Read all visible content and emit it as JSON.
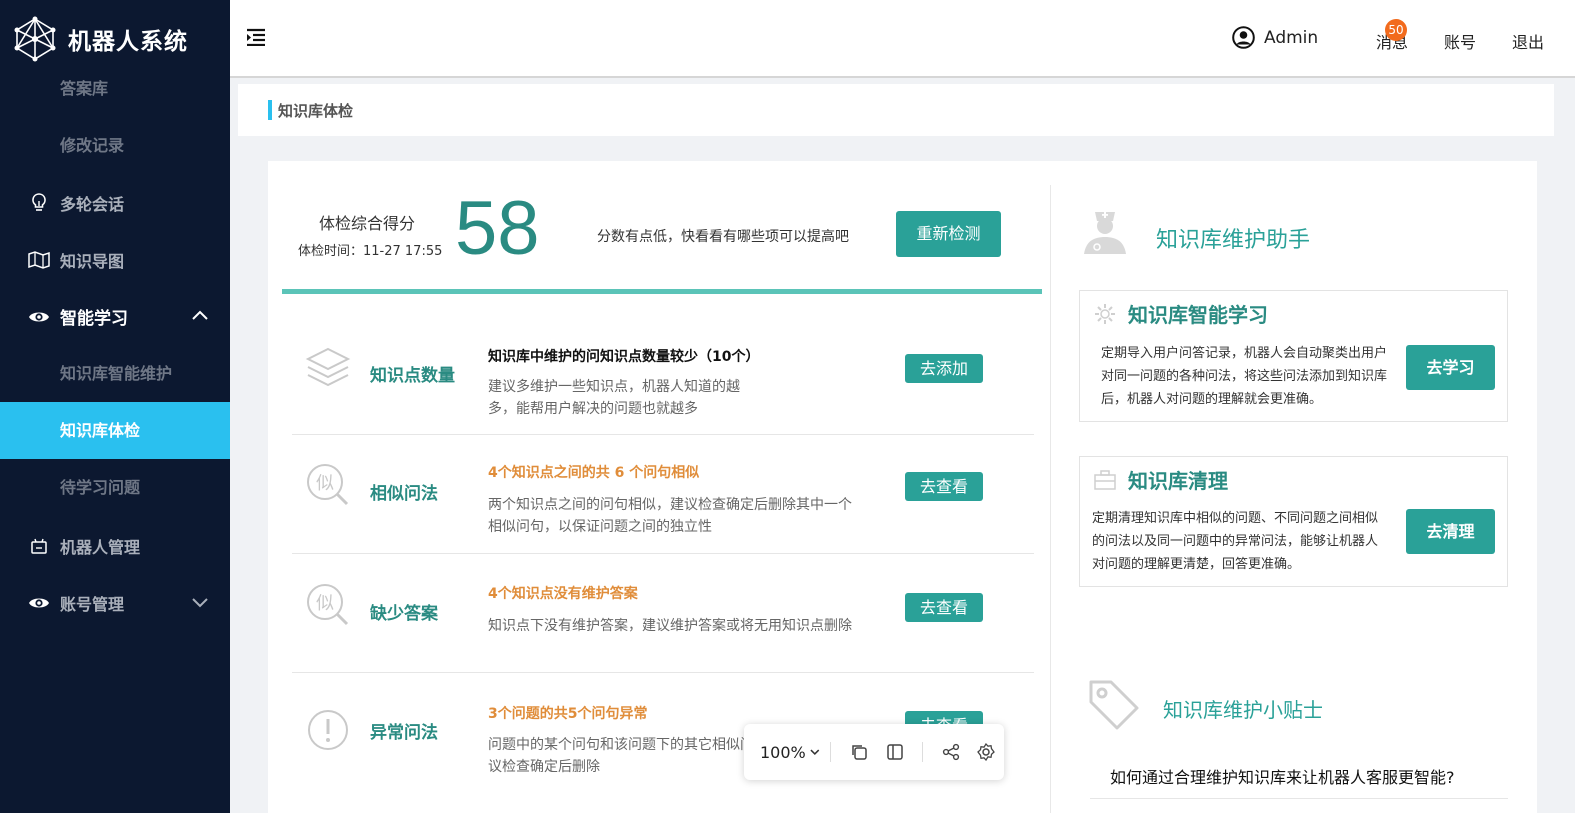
{
  "app": {
    "title": "机器人系统"
  },
  "sidebar": {
    "sub_items_top": [
      {
        "label": "答案库"
      },
      {
        "label": "修改记录"
      }
    ],
    "multi_turn": {
      "label": "多轮会话"
    },
    "knowledge_map": {
      "label": "知识导图"
    },
    "smart_learning": {
      "label": "智能学习"
    },
    "smart_sub": [
      {
        "label": "知识库智能维护"
      },
      {
        "label": "知识库体检"
      },
      {
        "label": "待学习问题"
      }
    ],
    "robot_mgmt": {
      "label": "机器人管理"
    },
    "account_mgmt": {
      "label": "账号管理"
    }
  },
  "header": {
    "user": "Admin",
    "messages": "消息",
    "message_count": "50",
    "account": "账号",
    "logout": "退出"
  },
  "breadcrumb": {
    "title": "知识库体检"
  },
  "score": {
    "label": "体检综合得分",
    "time": "体检时间：11-27 17:55",
    "value": "58",
    "tip": "分数有点低，快看看有哪些项可以提高吧",
    "recheck": "重新检测"
  },
  "checks": [
    {
      "name": "知识点数量",
      "title": "知识库中维护的问知识点数量较少（10个）",
      "desc": "建议多维护一些知识点，机器人知道的越多，能帮用户解决的问题也就越多",
      "action": "去添加"
    },
    {
      "name": "相似问法",
      "title": "4个知识点之间的共 6 个问句相似",
      "desc": "两个知识点之间的问句相似，建议检查确定后删除其中一个相似问句，以保证问题之间的独立性",
      "action": "去查看"
    },
    {
      "name": "缺少答案",
      "title": "4个知识点没有维护答案",
      "desc": "知识点下没有维护答案，建议维护答案或将无用知识点删除",
      "action": "去查看"
    },
    {
      "name": "异常问法",
      "title": "3个问题的共5个问句异常",
      "desc": "问题中的某个问句和该问题下的其它相似问句意思不同，建议检查确定后删除",
      "action": "去查看"
    }
  ],
  "assistant": {
    "title": "知识库维护助手",
    "cards": [
      {
        "title": "知识库智能学习",
        "desc": "定期导入用户问答记录，机器人会自动聚类出用户对同一问题的各种问法，将这些问法添加到知识库后，机器人对问题的理解就会更准确。",
        "action": "去学习"
      },
      {
        "title": "知识库清理",
        "desc": "定期清理知识库中相似的问题、不同问题之间相似的问法以及同一问题中的异常问法，能够让机器人对问题的理解更清楚，回答更准确。",
        "action": "去清理"
      }
    ],
    "tips_title": "知识库维护小贴士",
    "tips_question": "如何通过合理维护知识库来让机器人客服更智能?"
  },
  "zoombar": {
    "zoom": "100%"
  },
  "colors": {
    "sidebar_bg": "#0c1830",
    "active": "#2ac0ef",
    "teal": "#2aa198",
    "orange": "#e08d3a",
    "badge": "#f26b1d"
  }
}
